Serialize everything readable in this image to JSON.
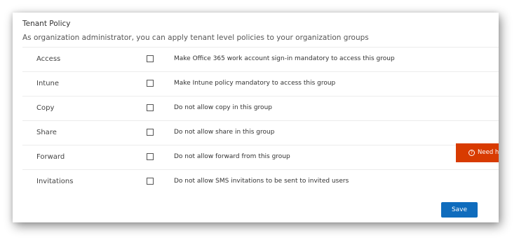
{
  "panel": {
    "title": "Tenant Policy",
    "subtitle": "As organization administrator, you can apply tenant level policies to your organization groups"
  },
  "policies": [
    {
      "label": "Access",
      "description": "Make Office 365 work account sign-in mandatory to access this group",
      "checked": false
    },
    {
      "label": "Intune",
      "description": "Make Intune policy mandatory to access this group",
      "checked": false
    },
    {
      "label": "Copy",
      "description": "Do not allow copy in this group",
      "checked": false
    },
    {
      "label": "Share",
      "description": "Do not allow share in this group",
      "checked": false
    },
    {
      "label": "Forward",
      "description": "Do not allow forward from this group",
      "checked": false
    },
    {
      "label": "Invitations",
      "description": "Do not allow SMS invitations to be sent to invited users",
      "checked": false
    }
  ],
  "save_button": {
    "label": "Save"
  },
  "help_tab": {
    "label": "Need he",
    "icon_glyph": "?",
    "icon": "question-circle-icon"
  },
  "colors": {
    "accent": "#0f6cbd",
    "help_tab": "#d83b01"
  }
}
